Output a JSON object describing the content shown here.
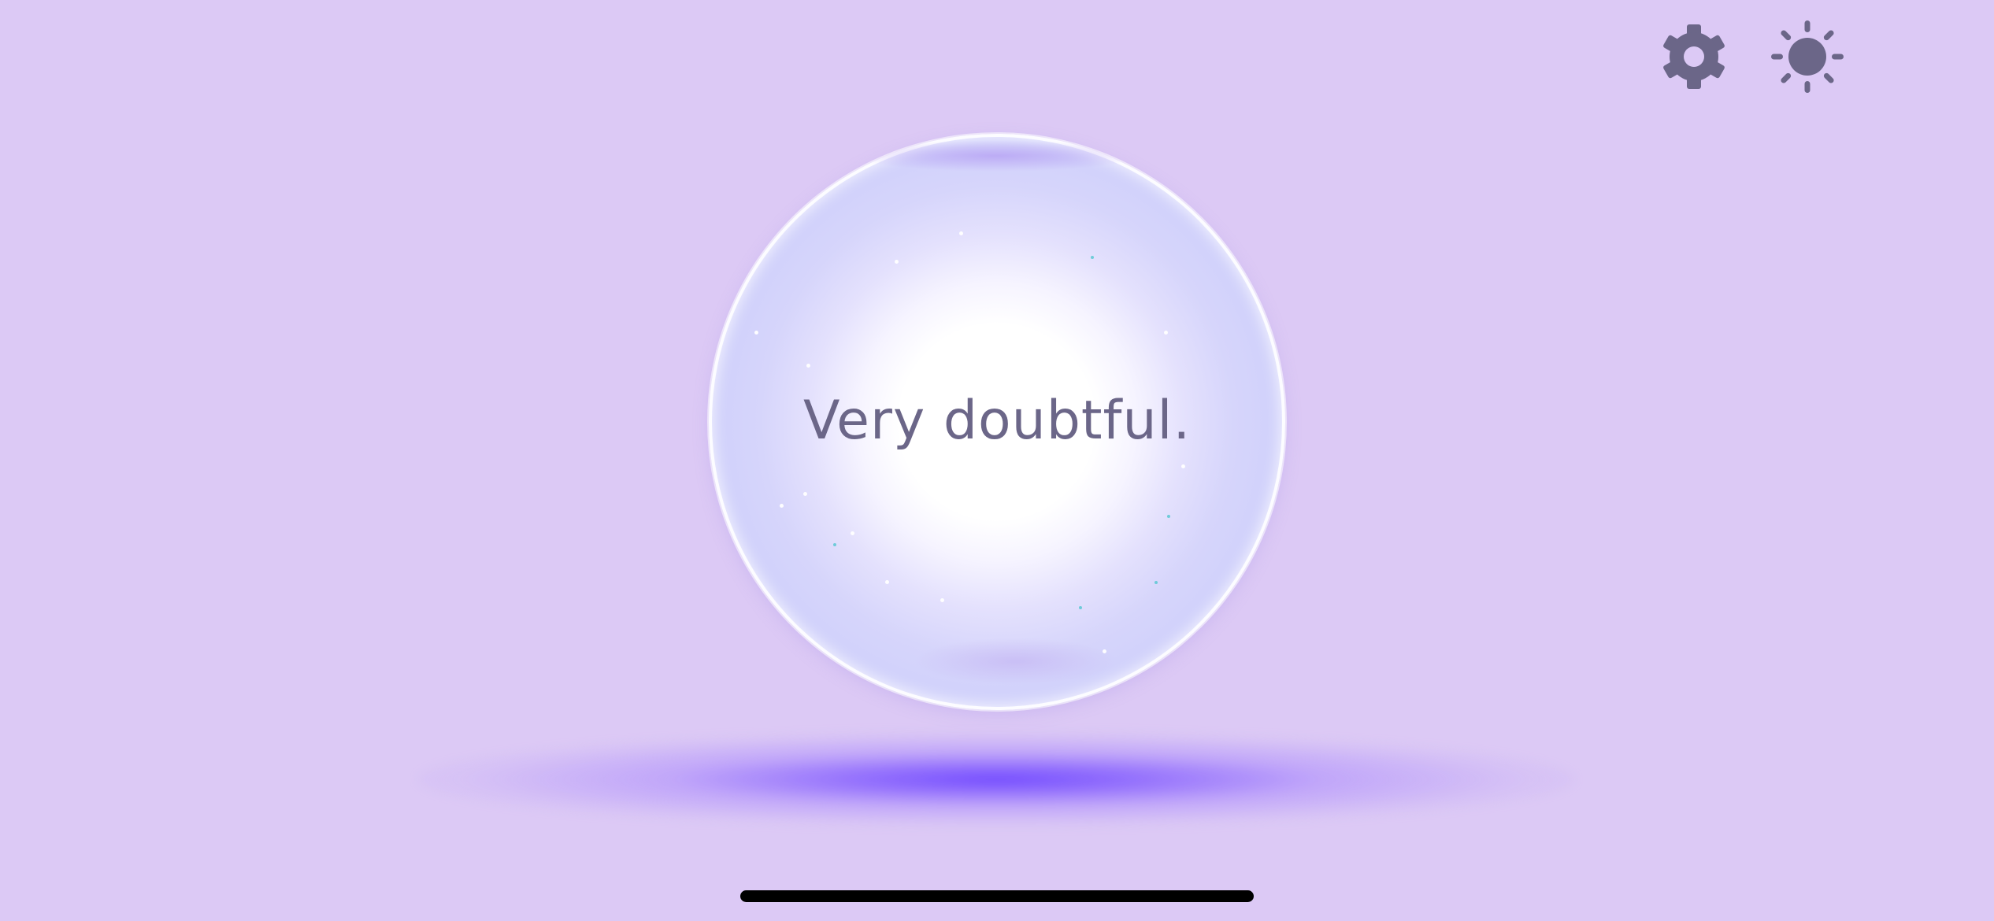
{
  "app": {
    "answer_text": "Very doubtful."
  },
  "controls": {
    "settings": {
      "icon": "gear-icon"
    },
    "theme": {
      "icon": "sun-icon"
    }
  },
  "colors": {
    "background": "#dcc9f5",
    "icon": "#6b6688",
    "answer_text": "#6b6688",
    "shadow_glow": "#6e46ff",
    "home_indicator": "#000000"
  }
}
